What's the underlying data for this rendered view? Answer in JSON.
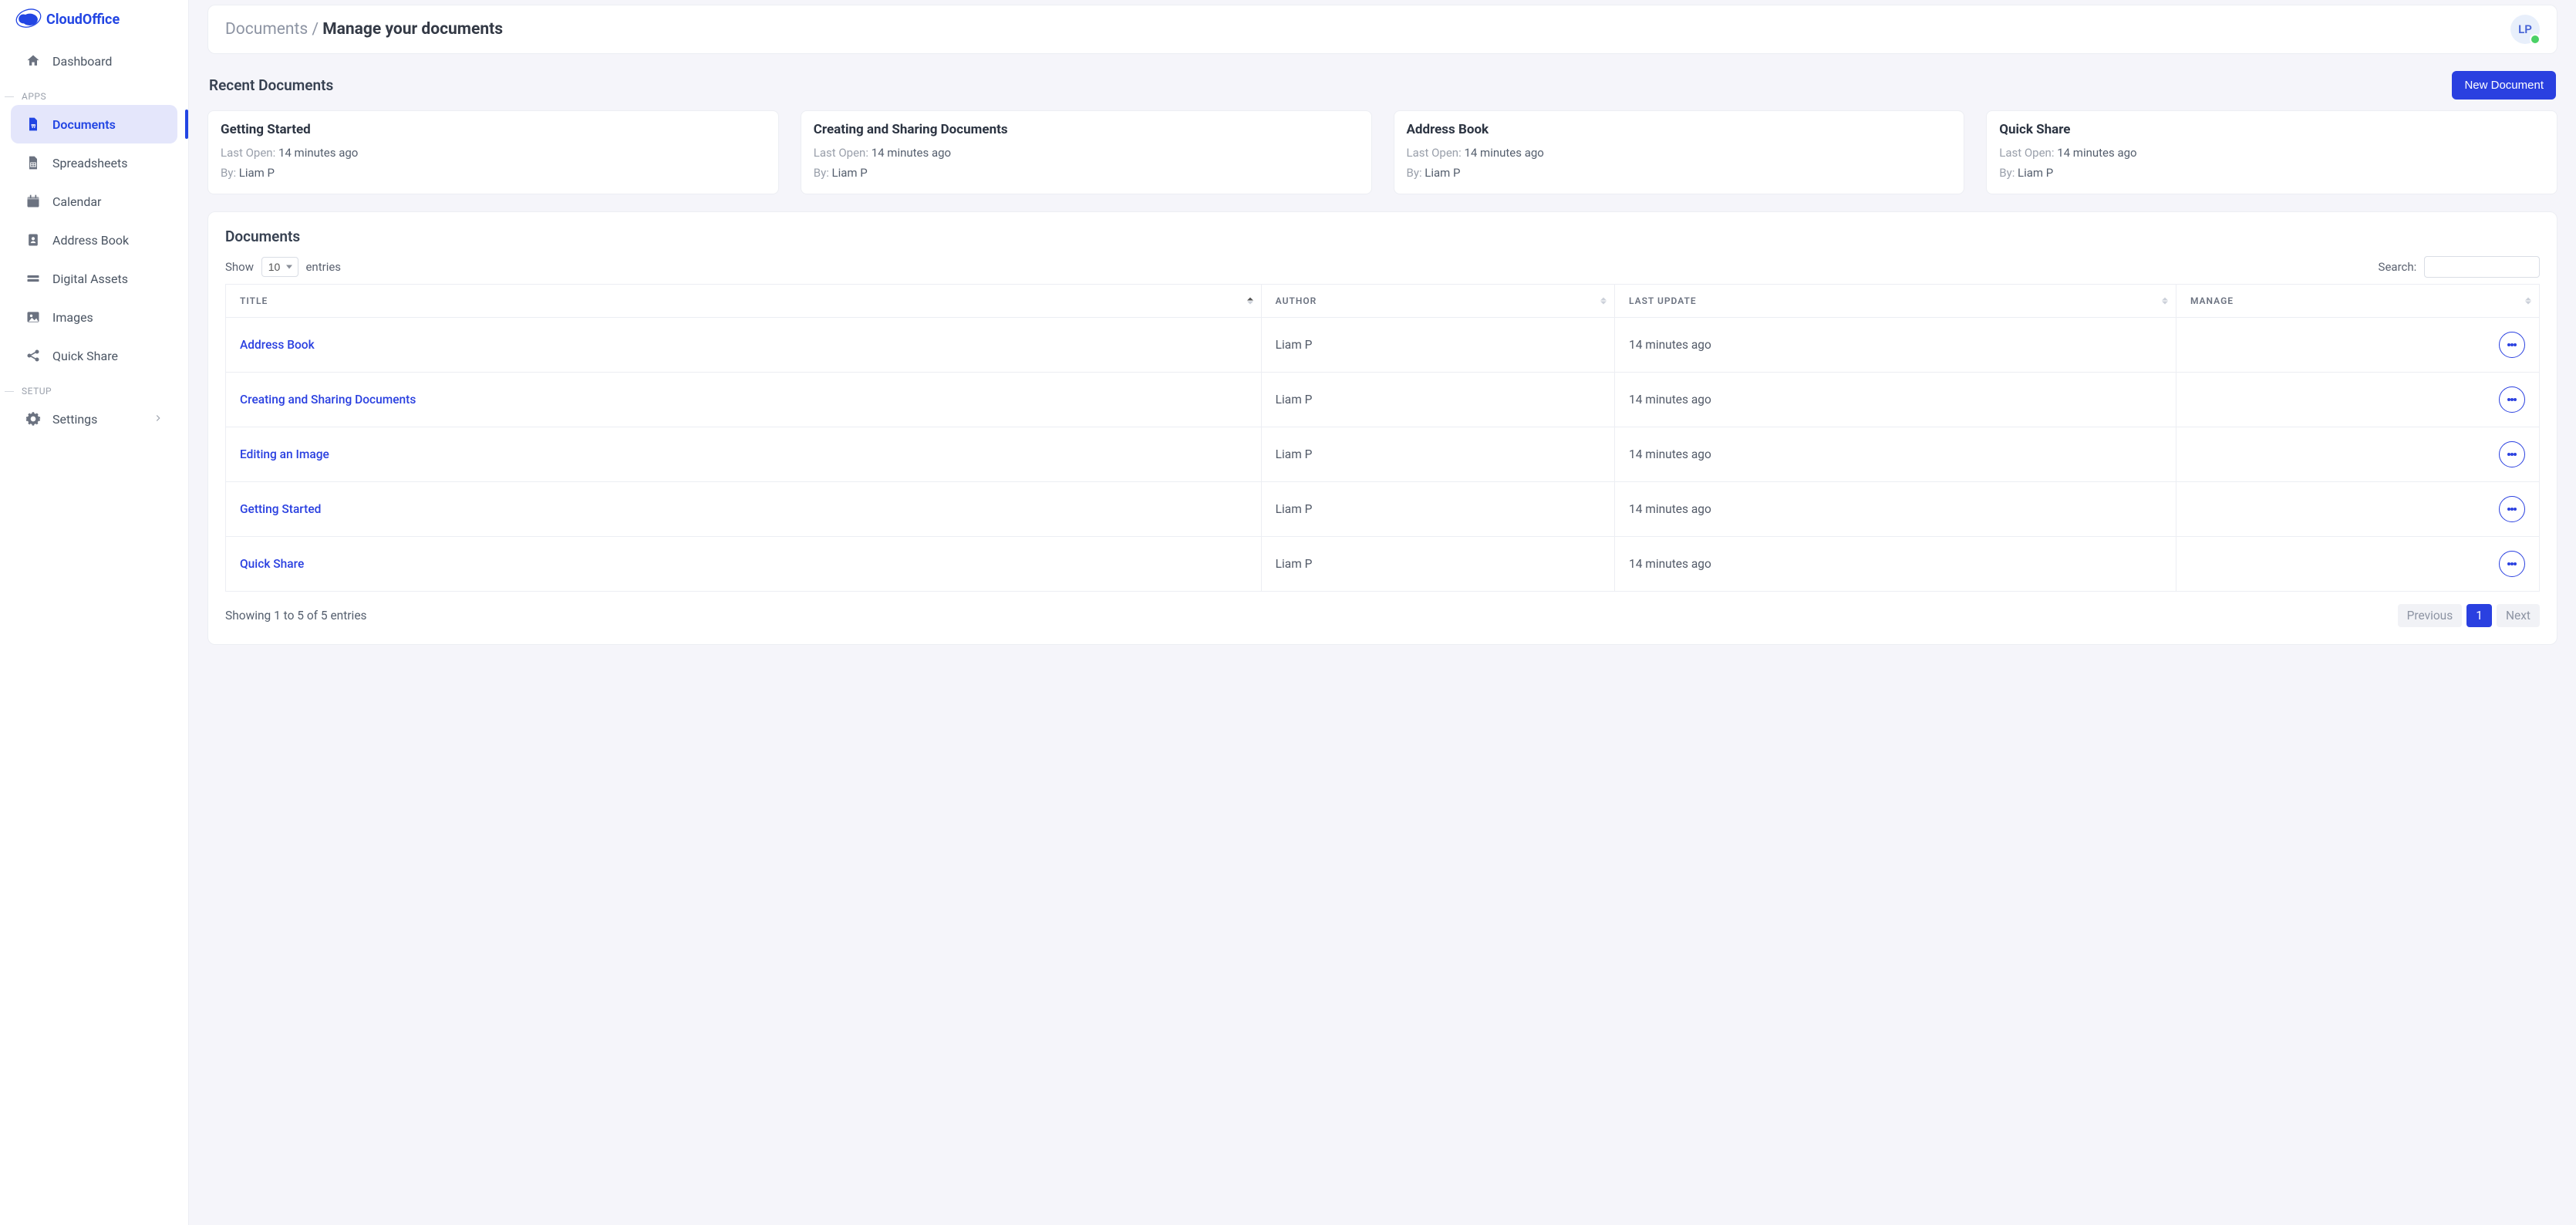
{
  "brand": {
    "name": "CloudOffice"
  },
  "sidebar": {
    "dashboard": "Dashboard",
    "groups": {
      "apps": "APPS",
      "setup": "SETUP"
    },
    "items": {
      "documents": "Documents",
      "spreadsheets": "Spreadsheets",
      "calendar": "Calendar",
      "addressbook": "Address Book",
      "assets": "Digital Assets",
      "images": "Images",
      "quickshare": "Quick Share",
      "settings": "Settings"
    }
  },
  "header": {
    "crumb_root": "Documents",
    "crumb_sep": " / ",
    "crumb_current": "Manage your documents",
    "avatar": "LP"
  },
  "recent": {
    "title": "Recent Documents",
    "new_btn": "New Document",
    "last_open_label": "Last Open: ",
    "by_label": "By: ",
    "cards": [
      {
        "title": "Getting Started",
        "last_open": "14 minutes ago",
        "by": "Liam P"
      },
      {
        "title": "Creating and Sharing Documents",
        "last_open": "14 minutes ago",
        "by": "Liam P"
      },
      {
        "title": "Address Book",
        "last_open": "14 minutes ago",
        "by": "Liam P"
      },
      {
        "title": "Quick Share",
        "last_open": "14 minutes ago",
        "by": "Liam P"
      }
    ]
  },
  "table": {
    "title": "Documents",
    "show": "Show",
    "entries": "entries",
    "length": "10",
    "search_label": "Search:",
    "cols": {
      "title": "TITLE",
      "author": "AUTHOR",
      "updated": "LAST UPDATE",
      "manage": "MANAGE"
    },
    "rows": [
      {
        "title": "Address Book",
        "author": "Liam P",
        "updated": "14 minutes ago"
      },
      {
        "title": "Creating and Sharing Documents",
        "author": "Liam P",
        "updated": "14 minutes ago"
      },
      {
        "title": "Editing an Image",
        "author": "Liam P",
        "updated": "14 minutes ago"
      },
      {
        "title": "Getting Started",
        "author": "Liam P",
        "updated": "14 minutes ago"
      },
      {
        "title": "Quick Share",
        "author": "Liam P",
        "updated": "14 minutes ago"
      }
    ],
    "info": "Showing 1 to 5 of 5 entries",
    "pager": {
      "prev": "Previous",
      "page": "1",
      "next": "Next"
    }
  }
}
